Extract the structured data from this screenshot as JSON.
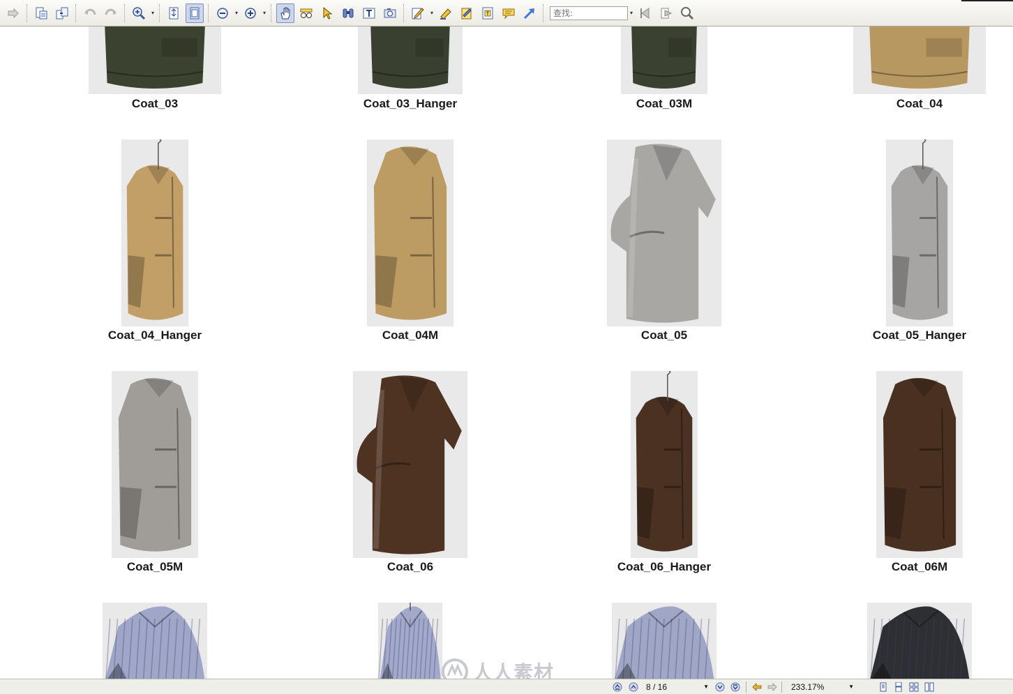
{
  "toolbar": {
    "search_placeholder": "查找:",
    "buttons": [
      "forward-arrow-icon",
      "sep",
      "create-doc-icon",
      "combine-docs-icon",
      "sep",
      "undo-icon",
      "redo-icon",
      "sep",
      "zoom-in-tool-icon",
      "drop",
      "sep",
      "actual-size-icon",
      "fit-page-icon",
      "sep",
      "zoom-out-icon",
      "drop",
      "zoom-in-icon",
      "drop",
      "sep",
      "hand-tool-icon",
      "snapshot-glasses-icon",
      "select-arrow-icon",
      "find-binoculars-icon",
      "text-select-icon",
      "camera-icon",
      "sep",
      "edit-pencil-icon",
      "drop",
      "highlight-pen-icon",
      "note-pad-icon",
      "text-box-icon",
      "comment-bubble-icon",
      "arrow-tool-icon",
      "sep"
    ]
  },
  "thumbnails": [
    {
      "label": "Coat_03",
      "color": "#3c4230",
      "kind": "top"
    },
    {
      "label": "Coat_03_Hanger",
      "color": "#3a4030",
      "kind": "top"
    },
    {
      "label": "Coat_03M",
      "color": "#3b4130",
      "kind": "top"
    },
    {
      "label": "Coat_04",
      "color": "#b89861",
      "kind": "top"
    },
    {
      "label": "Coat_04_Hanger",
      "color": "#c19f66",
      "kind": "long-hanger"
    },
    {
      "label": "Coat_04M",
      "color": "#bd9c63",
      "kind": "long"
    },
    {
      "label": "Coat_05",
      "color": "#a9a7a4",
      "kind": "wide"
    },
    {
      "label": "Coat_05_Hanger",
      "color": "#a6a5a3",
      "kind": "long-hanger"
    },
    {
      "label": "Coat_05M",
      "color": "#a09d99",
      "kind": "long"
    },
    {
      "label": "Coat_06",
      "color": "#4e3322",
      "kind": "wide"
    },
    {
      "label": "Coat_06_Hanger",
      "color": "#4a3122",
      "kind": "long-hanger"
    },
    {
      "label": "Coat_06M",
      "color": "#4a3020",
      "kind": "long"
    },
    {
      "label": "",
      "color": "#9fa6c8",
      "kind": "shirt"
    },
    {
      "label": "",
      "color": "#a3a9cb",
      "kind": "shirt-hanger"
    },
    {
      "label": "",
      "color": "#9fa6c6",
      "kind": "shirt"
    },
    {
      "label": "",
      "color": "#2e2f33",
      "kind": "shirt"
    }
  ],
  "statusbar": {
    "page_indicator": "8 / 16",
    "zoom_level": "233.17%"
  },
  "watermark": {
    "text": "人人素材"
  }
}
